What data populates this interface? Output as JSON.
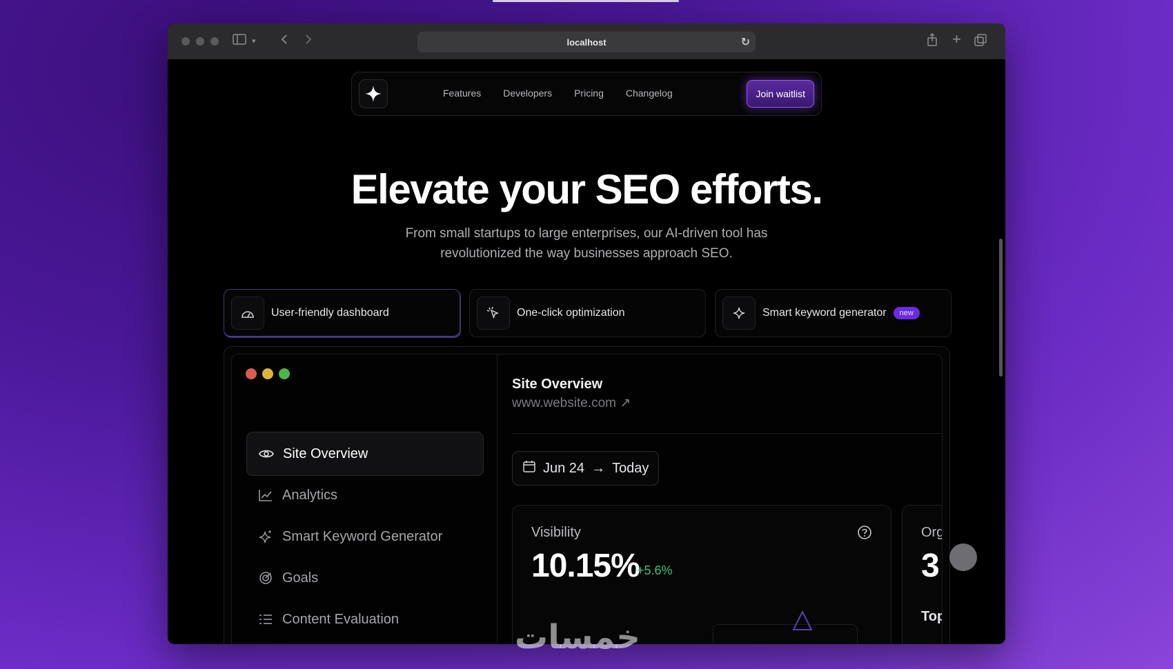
{
  "browser": {
    "url": "localhost"
  },
  "nav": {
    "links": [
      "Features",
      "Developers",
      "Pricing",
      "Changelog"
    ],
    "cta": "Join waitlist"
  },
  "hero": {
    "title": "Elevate your SEO efforts.",
    "subtitle_line1": "From small startups to large enterprises, our AI-driven tool has",
    "subtitle_line2": "revolutionized the way businesses approach SEO."
  },
  "features": [
    {
      "label": "User-friendly dashboard",
      "icon": "gauge-icon"
    },
    {
      "label": "One-click optimization",
      "icon": "cursor-click-icon"
    },
    {
      "label": "Smart keyword generator",
      "icon": "sparkles-icon",
      "badge": "new"
    }
  ],
  "dashboard": {
    "sidebar": [
      {
        "label": "Site Overview",
        "icon": "eye-icon"
      },
      {
        "label": "Analytics",
        "icon": "line-chart-icon"
      },
      {
        "label": "Smart Keyword Generator",
        "icon": "sparkles-icon"
      },
      {
        "label": "Goals",
        "icon": "target-icon"
      },
      {
        "label": "Content Evaluation",
        "icon": "list-icon"
      }
    ],
    "site_title": "Site Overview",
    "site_url": "www.website.com ↗",
    "date_from": "Jun 24",
    "date_to": "Today",
    "visibility": {
      "label": "Visibility",
      "value": "10.15%",
      "delta": "+5.6%"
    },
    "second_card": {
      "label": "Org",
      "value": "3",
      "sub": "Top"
    }
  },
  "colors": {
    "accent": "#7b3ff2",
    "positive": "#3ec47a",
    "dot_red": "#e05a4f",
    "dot_yellow": "#e0b43a",
    "dot_green": "#4fb54a"
  },
  "watermark": "خمسات"
}
